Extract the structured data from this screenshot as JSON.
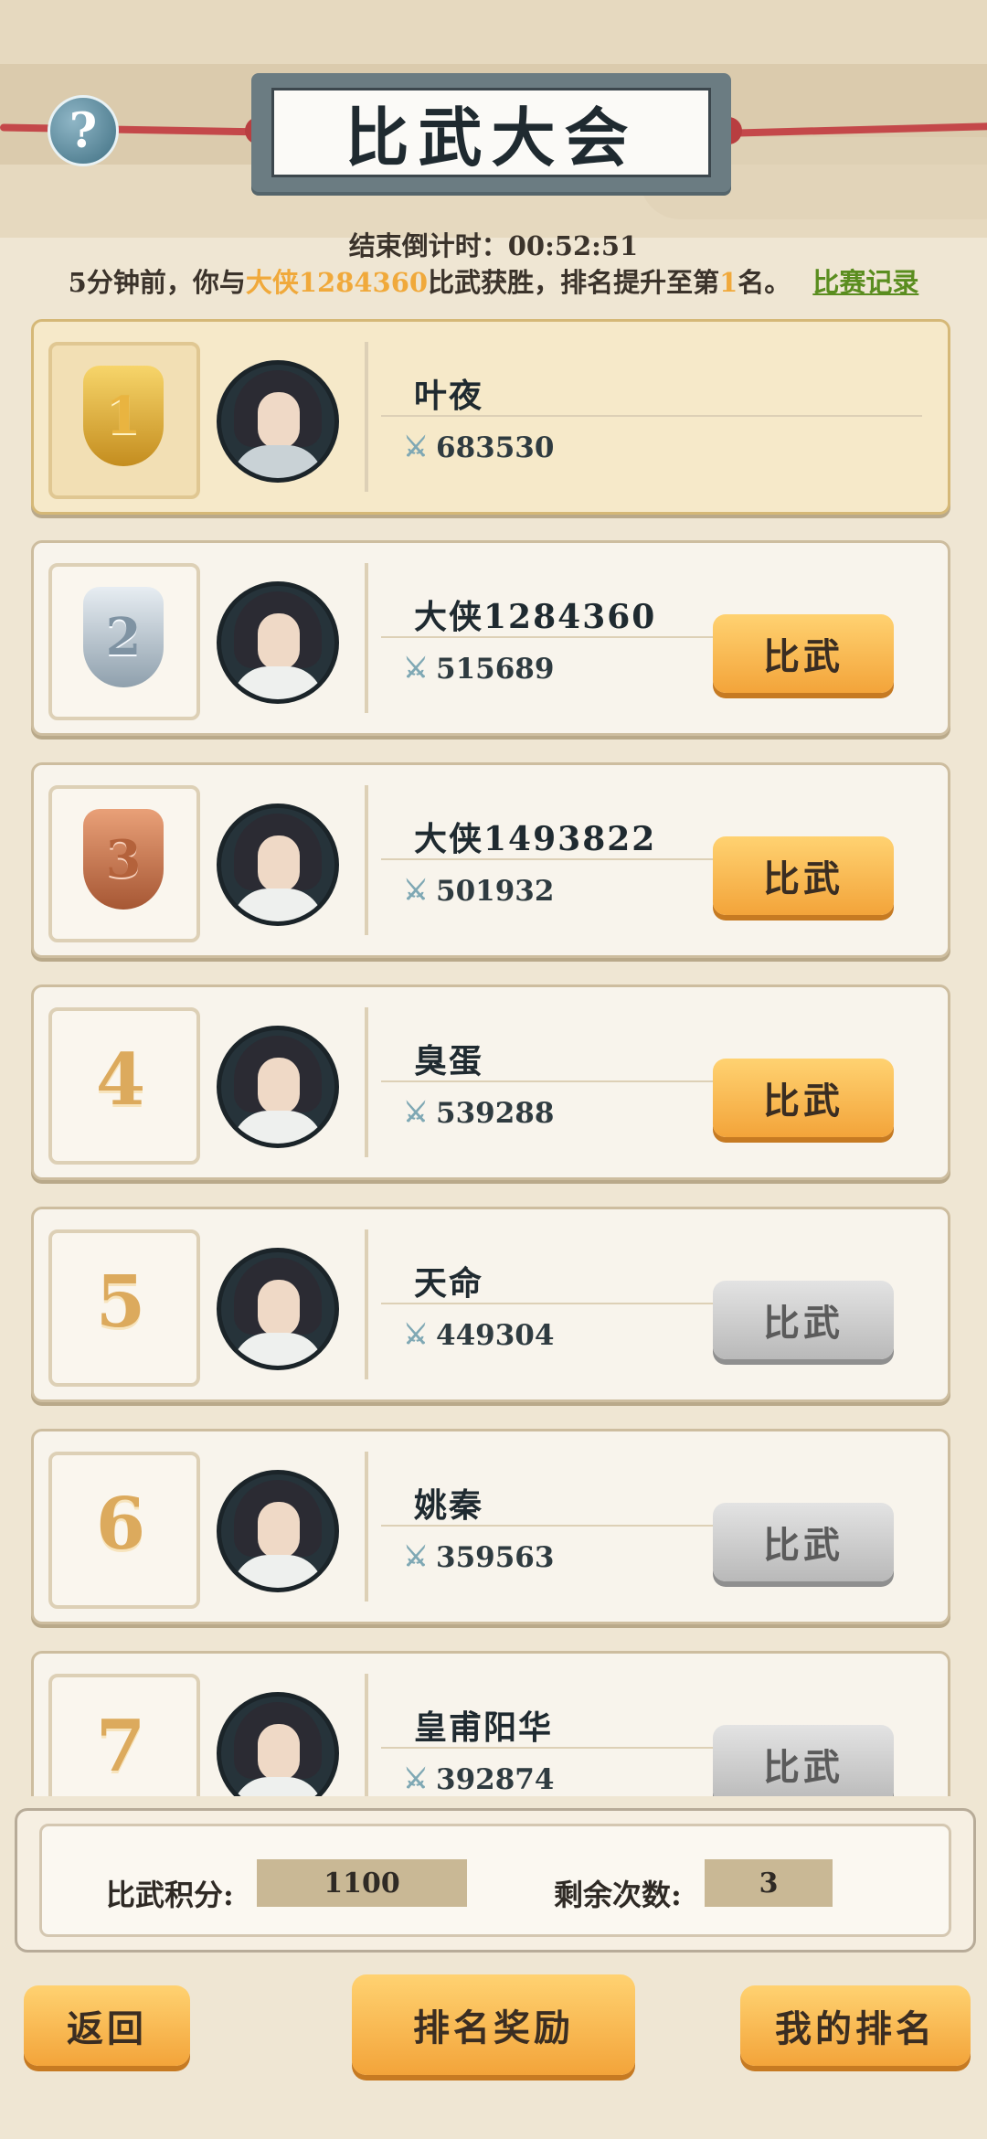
{
  "header": {
    "title": "比武大会",
    "help_symbol": "?"
  },
  "countdown": "结束倒计时：00:52:51",
  "news": {
    "prefix": "5分钟前，你与",
    "opponent": "大侠1284360",
    "middle": "比武获胜，排名提升至第",
    "rank": "1",
    "suffix": "名。",
    "link": "比赛记录"
  },
  "players": [
    {
      "rank": "1",
      "name": "叶夜",
      "power": "683530",
      "button": ""
    },
    {
      "rank": "2",
      "name": "大侠1284360",
      "power": "515689",
      "button": "比武"
    },
    {
      "rank": "3",
      "name": "大侠1493822",
      "power": "501932",
      "button": "比武"
    },
    {
      "rank": "4",
      "name": "臭蛋",
      "power": "539288",
      "button": "比武"
    },
    {
      "rank": "5",
      "name": "天命",
      "power": "449304",
      "button": "比武"
    },
    {
      "rank": "6",
      "name": "姚秦",
      "power": "359563",
      "button": "比武"
    },
    {
      "rank": "7",
      "name": "皇甫阳华",
      "power": "392874",
      "button": "比武"
    }
  ],
  "stats": {
    "score_label": "比武积分:",
    "score_value": "1100",
    "remaining_label": "剩余次数:",
    "remaining_value": "3"
  },
  "footer": {
    "back": "返回",
    "rewards": "排名奖励",
    "my_rank": "我的排名"
  },
  "icons": {
    "power": "crossed-swords-icon",
    "help": "question-icon"
  },
  "colors": {
    "accent_orange": "#f3a43a",
    "highlight_text": "#f0a93b",
    "link_green": "#5a8d1f",
    "disabled_gray": "#b9b9b9"
  }
}
